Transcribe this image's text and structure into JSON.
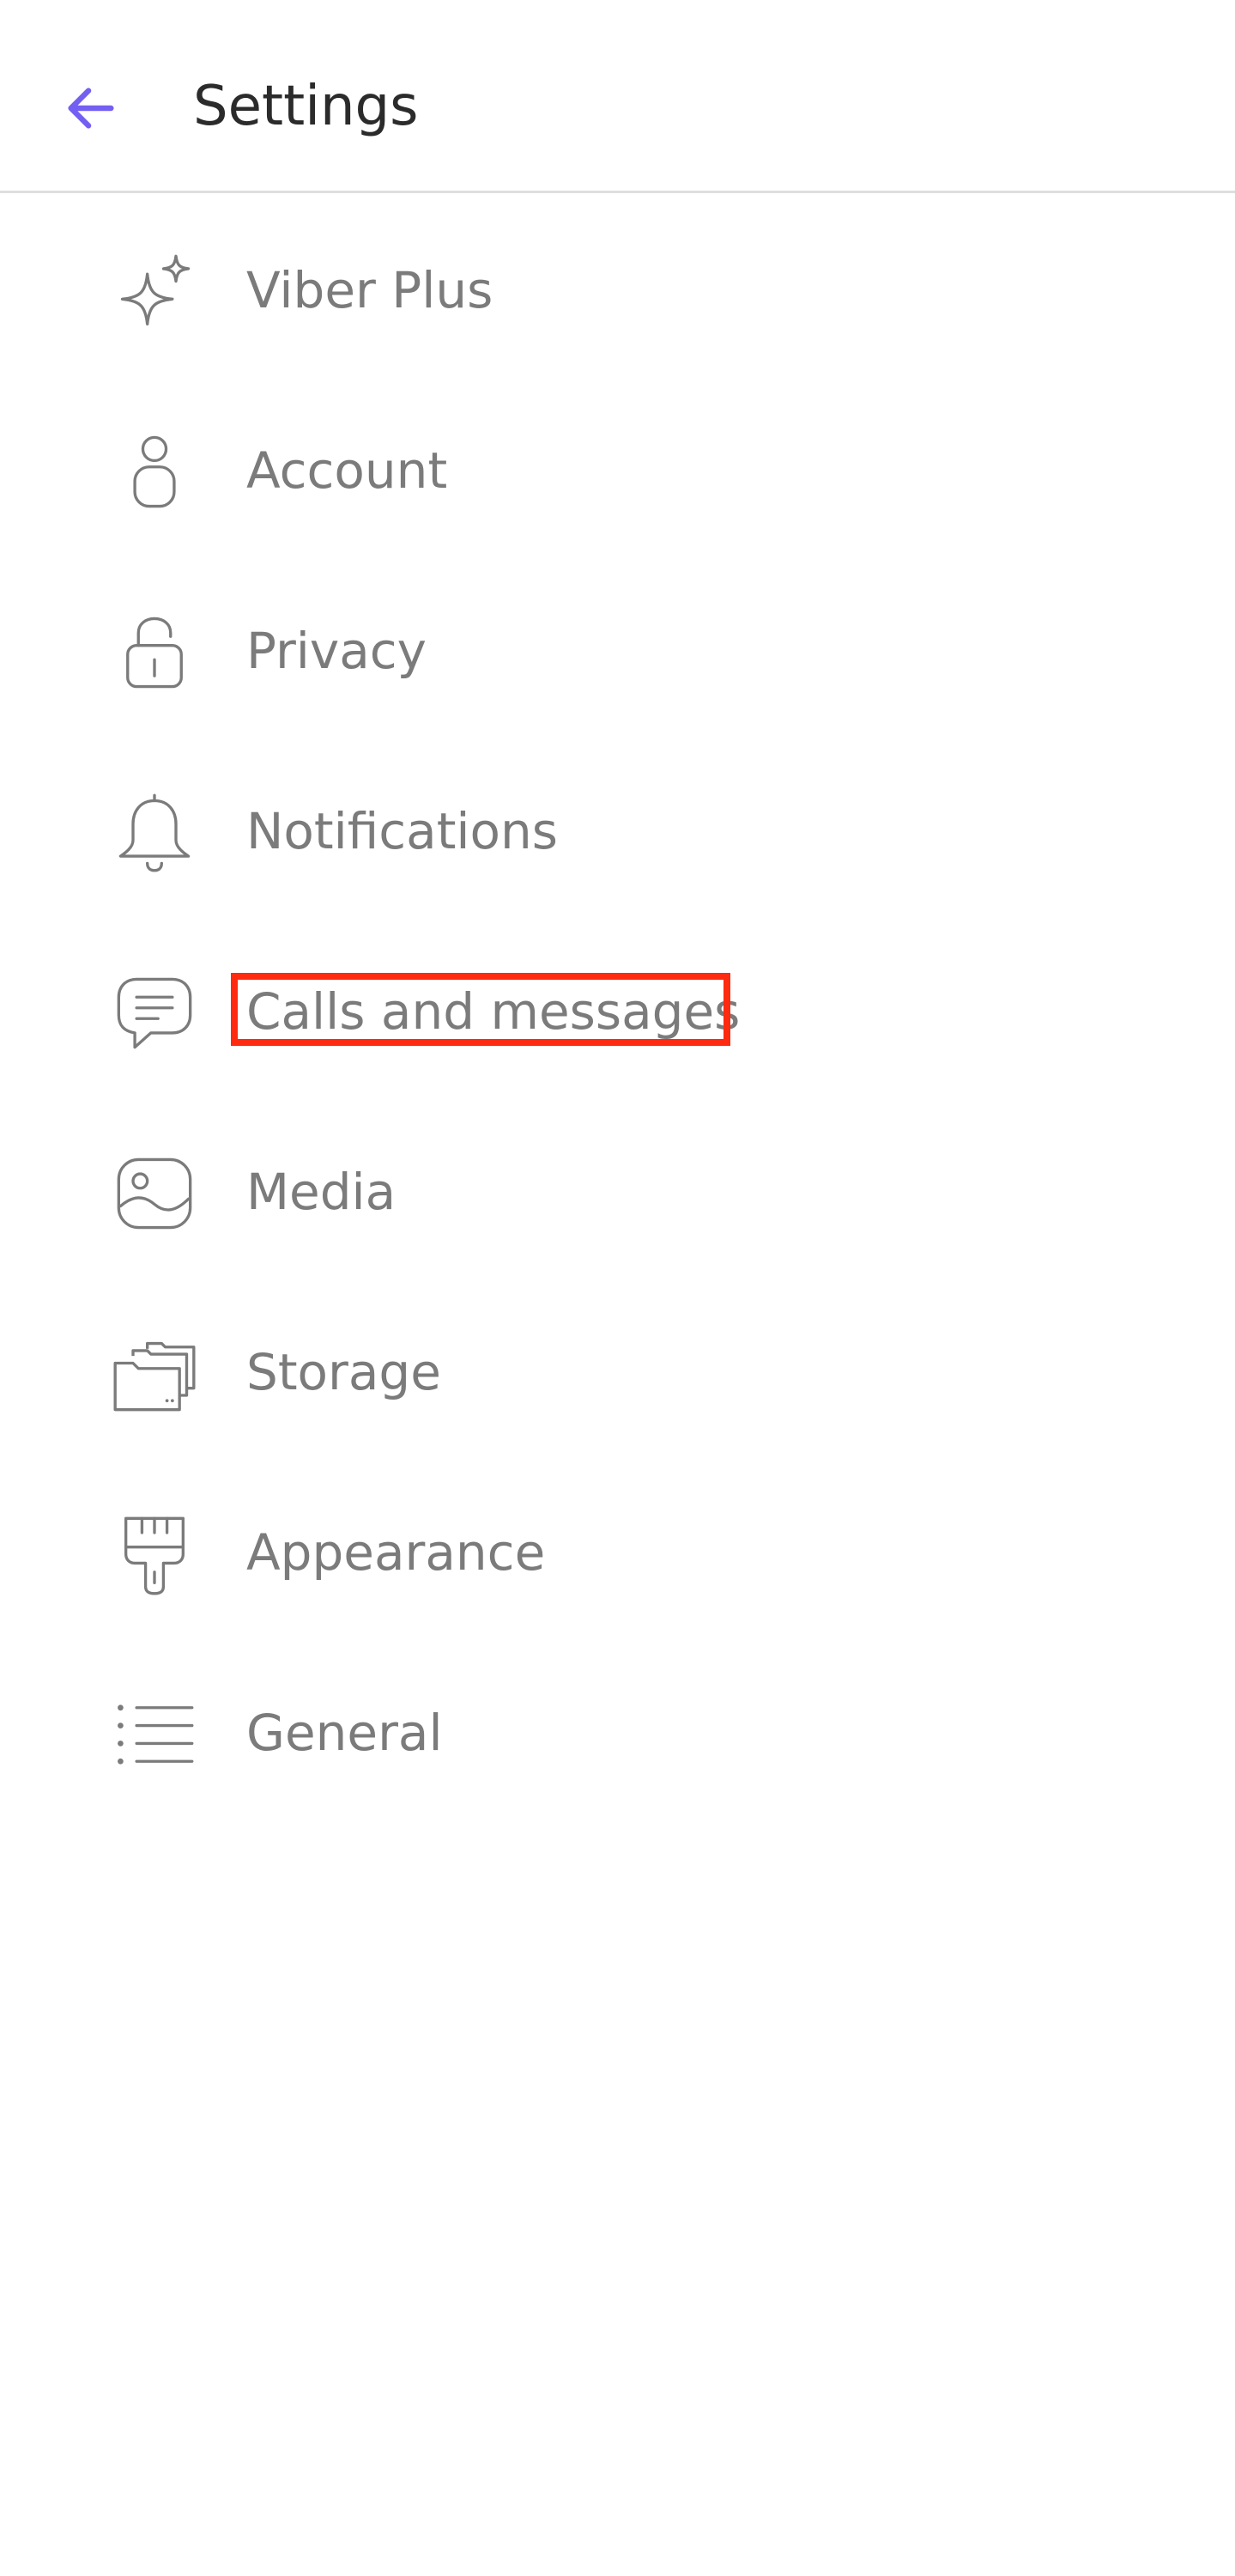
{
  "header": {
    "title": "Settings",
    "back_icon": "arrow-left-icon",
    "accent_color": "#7360f2"
  },
  "menu": {
    "items": [
      {
        "label": "Viber Plus",
        "icon": "sparkle-icon"
      },
      {
        "label": "Account",
        "icon": "person-icon"
      },
      {
        "label": "Privacy",
        "icon": "lock-icon"
      },
      {
        "label": "Notifications",
        "icon": "bell-icon"
      },
      {
        "label": "Calls and messages",
        "icon": "chat-bubble-icon"
      },
      {
        "label": "Media",
        "icon": "image-icon"
      },
      {
        "label": "Storage",
        "icon": "folders-icon"
      },
      {
        "label": "Appearance",
        "icon": "paintbrush-icon"
      },
      {
        "label": "General",
        "icon": "list-icon"
      }
    ]
  },
  "highlight": {
    "target": "Calls and messages",
    "color": "#ff2a10"
  }
}
